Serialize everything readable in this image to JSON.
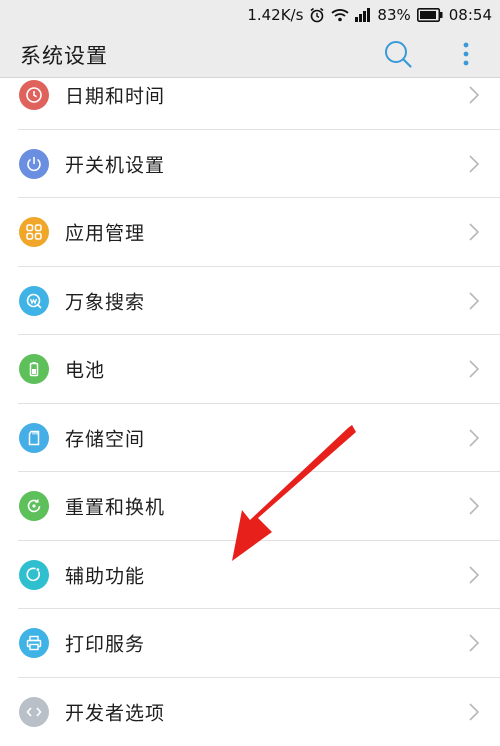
{
  "status_bar": {
    "speed": "1.42K/s",
    "battery": "83%",
    "time": "08:54"
  },
  "app_bar": {
    "title": "系统设置"
  },
  "items": [
    {
      "label": "日期和时间",
      "icon": "clock-icon",
      "color": "#e0625c"
    },
    {
      "label": "开关机设置",
      "icon": "power-icon",
      "color": "#6a8fe0"
    },
    {
      "label": "应用管理",
      "icon": "apps-grid-icon",
      "color": "#f0a629"
    },
    {
      "label": "万象搜索",
      "icon": "search-w-icon",
      "color": "#3fb3e6"
    },
    {
      "label": "电池",
      "icon": "battery-icon",
      "color": "#5dc05b"
    },
    {
      "label": "存储空间",
      "icon": "sd-card-icon",
      "color": "#45aee6"
    },
    {
      "label": "重置和换机",
      "icon": "reset-icon",
      "color": "#5dc05b"
    },
    {
      "label": "辅助功能",
      "icon": "accessibility-icon",
      "color": "#2fbfcf"
    },
    {
      "label": "打印服务",
      "icon": "printer-icon",
      "color": "#3fb3e6"
    },
    {
      "label": "开发者选项",
      "icon": "developer-icon",
      "color": "#b9c0c8"
    }
  ],
  "annotation": {
    "color": "#e8201c"
  }
}
